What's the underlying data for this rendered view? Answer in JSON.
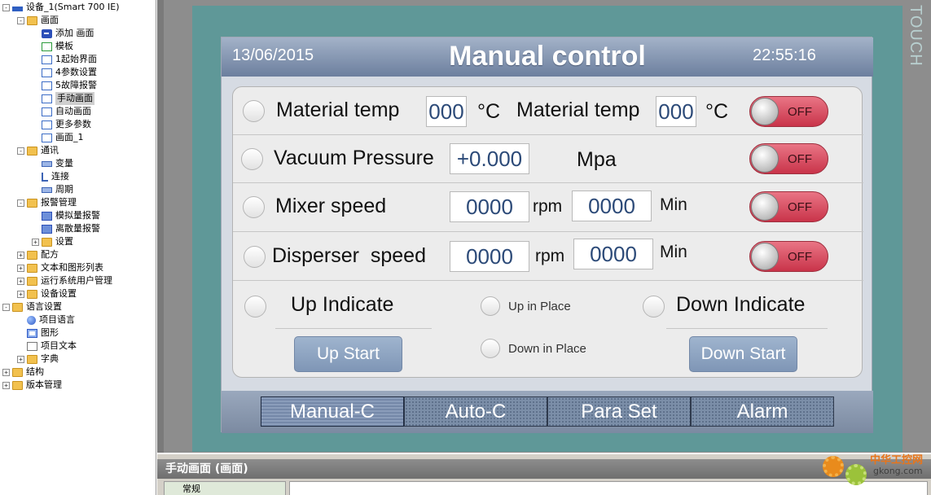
{
  "tree": {
    "items": [
      {
        "label": "设备_1(Smart 700 IE)",
        "toggle": "-",
        "icon": "dev",
        "level": 0
      },
      {
        "label": "画面",
        "toggle": "-",
        "icon": "folder",
        "level": 1
      },
      {
        "label": "添加 画面",
        "toggle": "",
        "icon": "plus",
        "level": 2
      },
      {
        "label": "模板",
        "toggle": "",
        "icon": "page green",
        "level": 2
      },
      {
        "label": "1起始界面",
        "toggle": "",
        "icon": "page",
        "level": 2
      },
      {
        "label": "4参数设置",
        "toggle": "",
        "icon": "page",
        "level": 2
      },
      {
        "label": "5故障报警",
        "toggle": "",
        "icon": "page",
        "level": 2
      },
      {
        "label": "手动画面",
        "toggle": "",
        "icon": "page",
        "level": 2,
        "selected": true
      },
      {
        "label": "自动画面",
        "toggle": "",
        "icon": "page",
        "level": 2
      },
      {
        "label": "更多参数",
        "toggle": "",
        "icon": "page",
        "level": 2
      },
      {
        "label": "画面_1",
        "toggle": "",
        "icon": "page",
        "level": 2
      },
      {
        "label": "通讯",
        "toggle": "-",
        "icon": "folder",
        "level": 1
      },
      {
        "label": "变量",
        "toggle": "",
        "icon": "var",
        "level": 2
      },
      {
        "label": "连接",
        "toggle": "",
        "icon": "link",
        "level": 2
      },
      {
        "label": "周期",
        "toggle": "",
        "icon": "var",
        "level": 2
      },
      {
        "label": "报警管理",
        "toggle": "-",
        "icon": "folder",
        "level": 1
      },
      {
        "label": "模拟量报警",
        "toggle": "",
        "icon": "alarm",
        "level": 2
      },
      {
        "label": "离散量报警",
        "toggle": "",
        "icon": "alarm",
        "level": 2
      },
      {
        "label": "设置",
        "toggle": "+",
        "icon": "folder",
        "level": 2
      },
      {
        "label": "配方",
        "toggle": "+",
        "icon": "folder",
        "level": 1
      },
      {
        "label": "文本和图形列表",
        "toggle": "+",
        "icon": "folder",
        "level": 1
      },
      {
        "label": "运行系统用户管理",
        "toggle": "+",
        "icon": "folder",
        "level": 1
      },
      {
        "label": "设备设置",
        "toggle": "+",
        "icon": "folder",
        "level": 1
      },
      {
        "label": "语言设置",
        "toggle": "-",
        "icon": "folder",
        "level": 0
      },
      {
        "label": "项目语言",
        "toggle": "",
        "icon": "globe",
        "level": 1
      },
      {
        "label": "图形",
        "toggle": "",
        "icon": "img",
        "level": 1
      },
      {
        "label": "项目文本",
        "toggle": "",
        "icon": "txt",
        "level": 1
      },
      {
        "label": "字典",
        "toggle": "+",
        "icon": "folder",
        "level": 1
      },
      {
        "label": "结构",
        "toggle": "+",
        "icon": "folder",
        "level": 0
      },
      {
        "label": "版本管理",
        "toggle": "+",
        "icon": "folder",
        "level": 0
      }
    ]
  },
  "panel": {
    "touch_label": "TOUCH"
  },
  "hmi": {
    "date": "13/06/2015",
    "title": "Manual control",
    "time": "22:55:16",
    "rows": {
      "material": {
        "label1": "Material temp",
        "value1": "000",
        "unit1": "°C",
        "label2": "Material temp",
        "value2": "000",
        "unit2": "°C",
        "switch": "OFF"
      },
      "vacuum": {
        "label": "Vacuum Pressure",
        "value": "+0.000",
        "unit": "Mpa",
        "switch": "OFF"
      },
      "mixer": {
        "label": "Mixer speed",
        "value1": "0000",
        "unit1": "rpm",
        "value2": "0000",
        "unit2": "Min",
        "switch": "OFF"
      },
      "disperser": {
        "label": "Disperser  speed",
        "value1": "0000",
        "unit1": "rpm",
        "value2": "0000",
        "unit2": "Min",
        "switch": "OFF"
      }
    },
    "indicators": {
      "up_indicate": "Up Indicate",
      "up_in_place": "Up in Place",
      "down_in_place": "Down in Place",
      "down_indicate": "Down Indicate",
      "up_start": "Up Start",
      "down_start": "Down Start"
    },
    "tabs": [
      "Manual-C",
      "Auto-C",
      "Para Set",
      "Alarm"
    ],
    "active_tab": "Manual-C"
  },
  "properties": {
    "title": "手动画面 (画面)",
    "tab": "常规"
  },
  "watermark": {
    "text1": "中华工控网",
    "text2": "gkong.com"
  },
  "colors": {
    "switch_off": "#d94a5e",
    "panel_teal": "#5f9898",
    "header_blue": "#7b8ea8"
  }
}
